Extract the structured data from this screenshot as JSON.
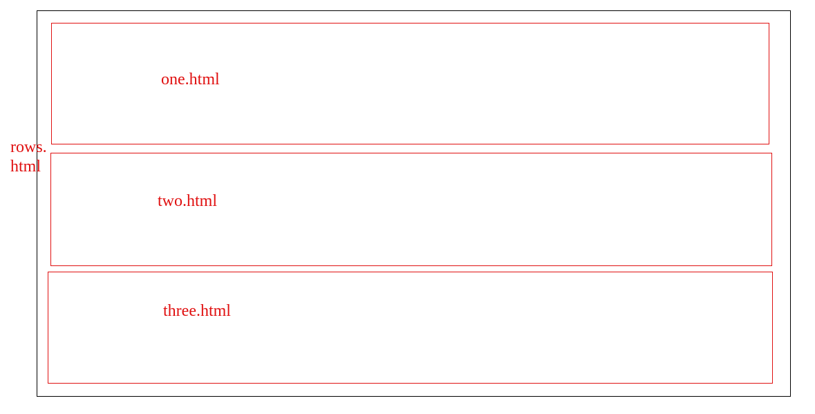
{
  "diagram": {
    "outer_label_line1": "rows.",
    "outer_label_line2": "html",
    "rows": [
      {
        "label": "one.html"
      },
      {
        "label": "two.html"
      },
      {
        "label": "three.html"
      }
    ],
    "colors": {
      "outer_border": "#000000",
      "row_border": "#e01010",
      "text": "#e01010"
    }
  }
}
